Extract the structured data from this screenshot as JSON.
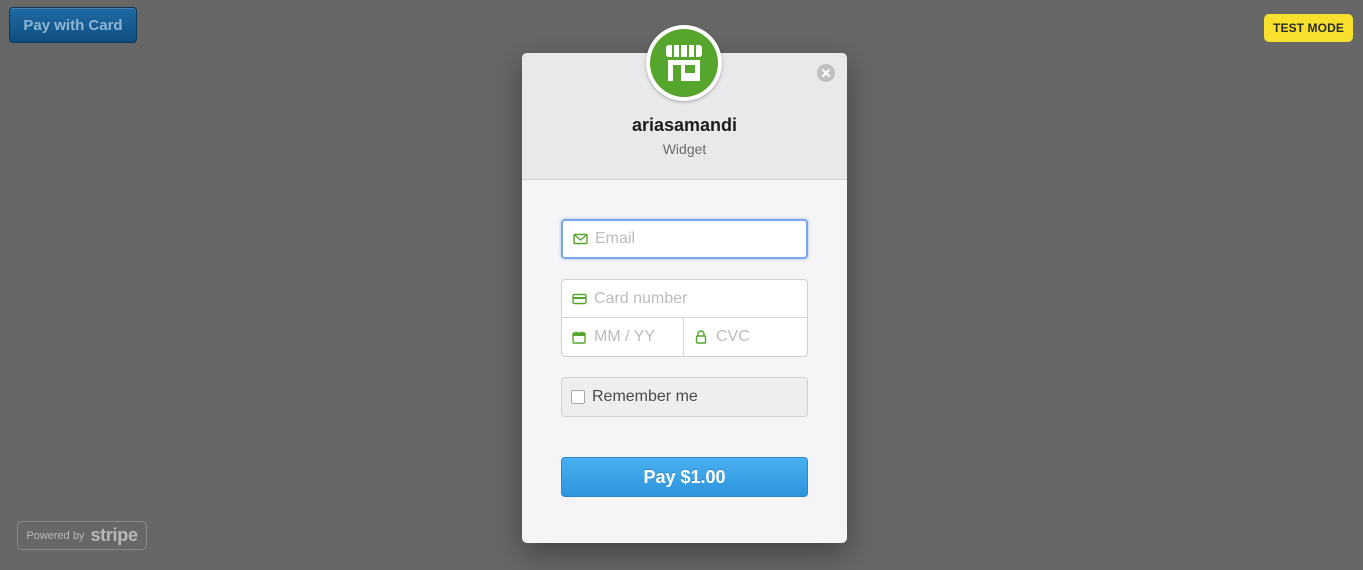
{
  "page": {
    "pay_with_card_label": "Pay with Card",
    "test_mode_label": "TEST MODE",
    "powered_by_label": "Powered by",
    "powered_by_brand": "stripe"
  },
  "modal": {
    "merchant_name": "ariasamandi",
    "description": "Widget",
    "logo_icon": "store-icon",
    "close_icon": "close-icon",
    "email": {
      "placeholder": "Email",
      "value": "",
      "icon": "envelope-icon"
    },
    "card_number": {
      "placeholder": "Card number",
      "value": "",
      "icon": "credit-card-icon"
    },
    "expiry": {
      "placeholder": "MM / YY",
      "value": "",
      "icon": "calendar-icon"
    },
    "cvc": {
      "placeholder": "CVC",
      "value": "",
      "icon": "lock-icon"
    },
    "remember_me_label": "Remember me",
    "remember_me_checked": false,
    "pay_button_label": "Pay $1.00"
  },
  "colors": {
    "background": "#676767",
    "accent_green": "#56a52c",
    "pay_button": "#3aa2e6",
    "test_mode_badge": "#f7e12c",
    "focus_border": "#79a6e8"
  }
}
